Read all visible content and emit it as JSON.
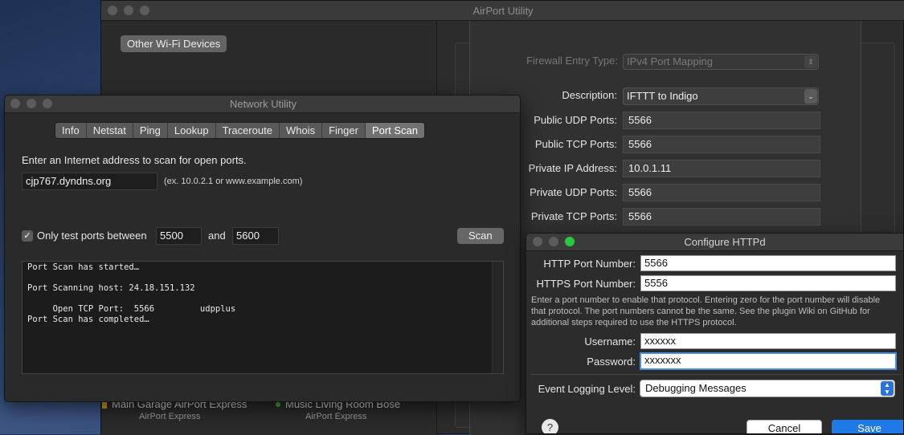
{
  "airport": {
    "title": "AirPort Utility",
    "other_devices_button": "Other Wi-Fi Devices",
    "firewall_entry_type_label": "Firewall Entry Type:",
    "firewall_entry_type_value": "IPv4 Port Mapping",
    "description_label": "Description:",
    "description_value": "IFTTT to Indigo",
    "public_udp_label": "Public UDP Ports:",
    "public_udp_value": "5566",
    "public_tcp_label": "Public TCP Ports:",
    "public_tcp_value": "5566",
    "private_ip_label": "Private IP Address:",
    "private_ip_value": "10.0.1.11",
    "private_udp_label": "Private UDP Ports:",
    "private_udp_value": "5566",
    "private_tcp_label": "Private TCP Ports:",
    "private_tcp_value": "5566",
    "devices": [
      {
        "name": "Main Garage AirPort Express",
        "type": "AirPort Express"
      },
      {
        "name": "Music Living Room Bose",
        "type": "AirPort Express"
      }
    ],
    "colors": {
      "device_status_1": "#d4a017",
      "device_status_2": "#3cb043"
    }
  },
  "network_utility": {
    "title": "Network Utility",
    "tabs": [
      "Info",
      "Netstat",
      "Ping",
      "Lookup",
      "Traceroute",
      "Whois",
      "Finger",
      "Port Scan"
    ],
    "active_tab": "Port Scan",
    "prompt": "Enter an Internet address to scan for open ports.",
    "address_value": "cjp767.dyndns.org",
    "address_hint": "(ex. 10.0.2.1 or www.example.com)",
    "only_test_label": "Only test ports between",
    "only_test_checked": true,
    "port_from": "5500",
    "and_label": "and",
    "port_to": "5600",
    "scan_button": "Scan",
    "output_lines": [
      "Port Scan has started…",
      "",
      "Port Scanning host: 24.18.151.132",
      "",
      "     Open TCP Port:  5566         udpplus",
      "Port Scan has completed…"
    ]
  },
  "configure_httpd": {
    "title": "Configure HTTPd",
    "http_port_label": "HTTP Port Number:",
    "http_port_value": "5566",
    "https_port_label": "HTTPS Port Number:",
    "https_port_value": "5556",
    "help_text": "Enter a port number to enable that protocol.  Entering zero for the port number will disable that protocol.  The port numbers cannot be the same.  See the plugin Wiki on GitHub for additional steps required to use the HTTPS protocol.",
    "username_label": "Username:",
    "username_value": "xxxxxx",
    "password_label": "Password:",
    "password_value": "xxxxxxx",
    "event_logging_label": "Event Logging Level:",
    "event_logging_value": "Debugging Messages",
    "help_button": "?",
    "cancel_button": "Cancel",
    "save_button": "Save",
    "colors": {
      "zoom_light": "#27c93f",
      "save_button": "#1f7ae8",
      "focus_ring": "#4a90e2"
    }
  }
}
